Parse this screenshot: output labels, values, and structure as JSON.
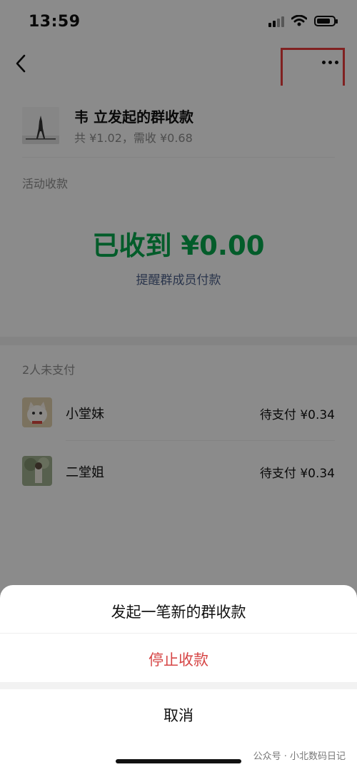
{
  "status_bar": {
    "time": "13:59"
  },
  "header": {
    "title": "韦  立发起的群收款",
    "summary": "共 ¥1.02，需收 ¥0.68"
  },
  "activity": {
    "section_label": "活动收款",
    "received_text": "已收到 ¥0.00",
    "remind_text": "提醒群成员付款"
  },
  "unpaid": {
    "label": "2人未支付",
    "members": [
      {
        "name": "小堂妹",
        "status": "待支付 ¥0.34"
      },
      {
        "name": "二堂姐",
        "status": "待支付 ¥0.34"
      }
    ]
  },
  "action_sheet": {
    "new_collection": "发起一笔新的群收款",
    "stop_collection": "停止收款",
    "cancel": "取消"
  },
  "watermark": "公众号 · 小北数码日记",
  "colors": {
    "accent_green": "#07a34a",
    "link_blue": "#4a5d86",
    "danger_red": "#d64545",
    "highlight_red": "#e23b3b"
  },
  "icons": [
    "back-icon",
    "more-icon",
    "signal-icon",
    "wifi-icon",
    "battery-icon"
  ]
}
